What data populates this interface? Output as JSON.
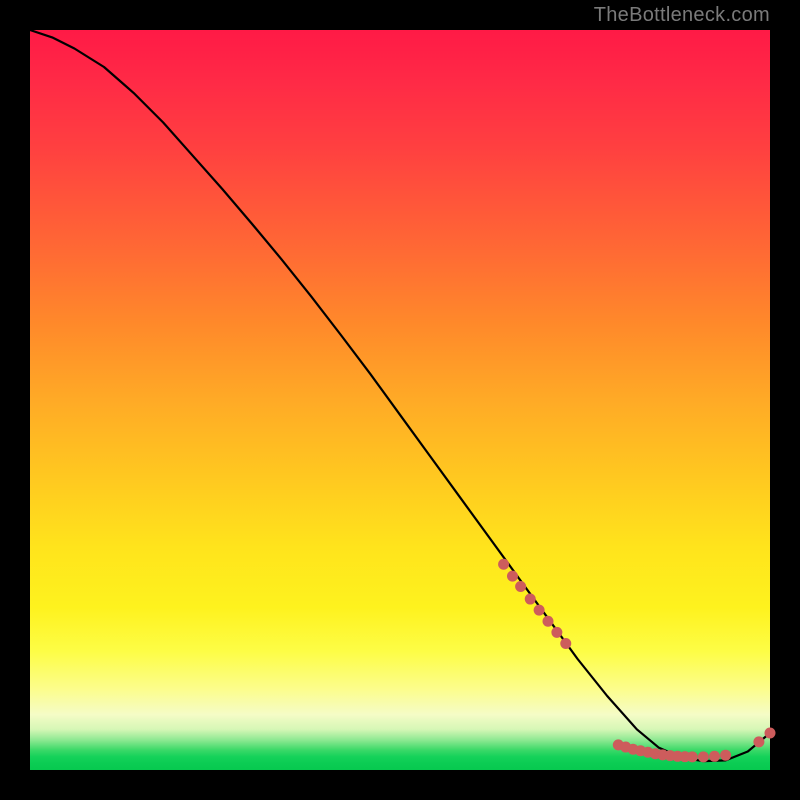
{
  "watermark": "TheBottleneck.com",
  "chart_data": {
    "type": "line",
    "title": "",
    "xlabel": "",
    "ylabel": "",
    "xlim": [
      0,
      100
    ],
    "ylim": [
      0,
      100
    ],
    "grid": false,
    "legend": false,
    "series": [
      {
        "name": "bottleneck-curve",
        "x": [
          0,
          3,
          6,
          10,
          14,
          18,
          22,
          26,
          30,
          34,
          38,
          42,
          46,
          50,
          54,
          58,
          62,
          66,
          70,
          74,
          78,
          82,
          85,
          88,
          91,
          94,
          97,
          100
        ],
        "y": [
          100,
          99,
          97.5,
          95,
          91.5,
          87.5,
          83,
          78.5,
          73.8,
          69,
          64,
          58.8,
          53.5,
          48,
          42.5,
          37,
          31.5,
          26,
          20.5,
          15,
          10,
          5.5,
          3,
          1.7,
          1.2,
          1.3,
          2.5,
          5
        ]
      }
    ],
    "highlighted_points": {
      "name": "marker-dots",
      "points": [
        {
          "x": 64,
          "y": 27.8
        },
        {
          "x": 65.2,
          "y": 26.2
        },
        {
          "x": 66.3,
          "y": 24.8
        },
        {
          "x": 67.6,
          "y": 23.1
        },
        {
          "x": 68.8,
          "y": 21.6
        },
        {
          "x": 70,
          "y": 20.1
        },
        {
          "x": 71.2,
          "y": 18.6
        },
        {
          "x": 72.4,
          "y": 17.1
        },
        {
          "x": 79.5,
          "y": 3.4
        },
        {
          "x": 80.5,
          "y": 3.1
        },
        {
          "x": 81.5,
          "y": 2.8
        },
        {
          "x": 82.5,
          "y": 2.6
        },
        {
          "x": 83.5,
          "y": 2.4
        },
        {
          "x": 84.5,
          "y": 2.2
        },
        {
          "x": 85.5,
          "y": 2.05
        },
        {
          "x": 86.5,
          "y": 1.95
        },
        {
          "x": 87.5,
          "y": 1.85
        },
        {
          "x": 88.5,
          "y": 1.8
        },
        {
          "x": 89.5,
          "y": 1.78
        },
        {
          "x": 91,
          "y": 1.78
        },
        {
          "x": 92.5,
          "y": 1.85
        },
        {
          "x": 94,
          "y": 2.0
        },
        {
          "x": 98.5,
          "y": 3.8
        },
        {
          "x": 100,
          "y": 5.0
        }
      ]
    }
  }
}
